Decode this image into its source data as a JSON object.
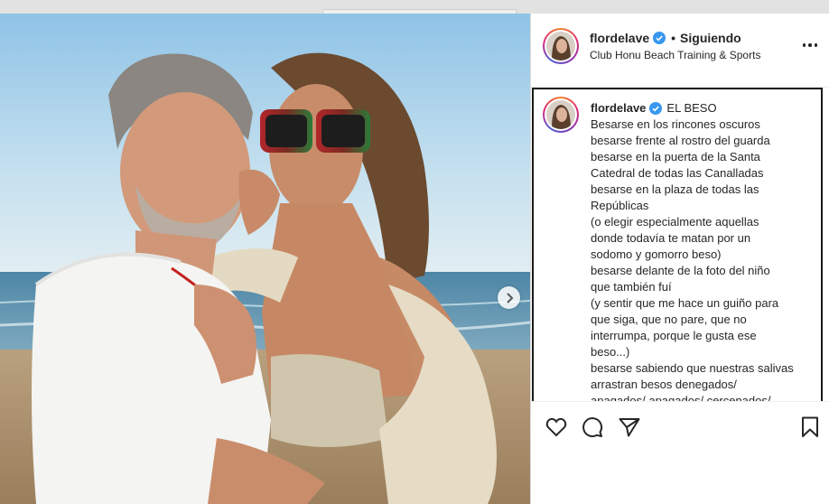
{
  "post": {
    "username": "flordelave",
    "follow_status": "Siguiendo",
    "location": "Club Honu Beach Training & Sports",
    "caption_title": "EL BESO",
    "caption_lines": [
      "Besarse en los rincones oscuros",
      "besarse frente al rostro del guarda",
      "besarse en la puerta de la Santa",
      "Catedral de todas las Canalladas",
      "besarse en la plaza de todas las",
      "Repúblicas",
      "(o elegir especialmente aquellas",
      "donde todavía te matan por un",
      "sodomo y gomorro beso)",
      "besarse delante de la foto del niño",
      "que también fuí",
      "(y sentir que me hace un guiño para",
      "que siga, que no pare, que no",
      "interrumpa, porque le gusta ese",
      "beso...)",
      "besarse sabiendo que nuestras salivas",
      "arrastran besos denegados/",
      "apagados/ apagados/ cercenados/"
    ]
  },
  "icons": {
    "verified": "verified-badge-icon",
    "more": "more-options-icon",
    "like": "heart-icon",
    "comment": "comment-icon",
    "share": "paper-plane-icon",
    "save": "bookmark-icon",
    "next": "chevron-right-icon"
  },
  "colors": {
    "verified": "#3897f0",
    "text": "#262626",
    "border": "#dbdbdb"
  }
}
